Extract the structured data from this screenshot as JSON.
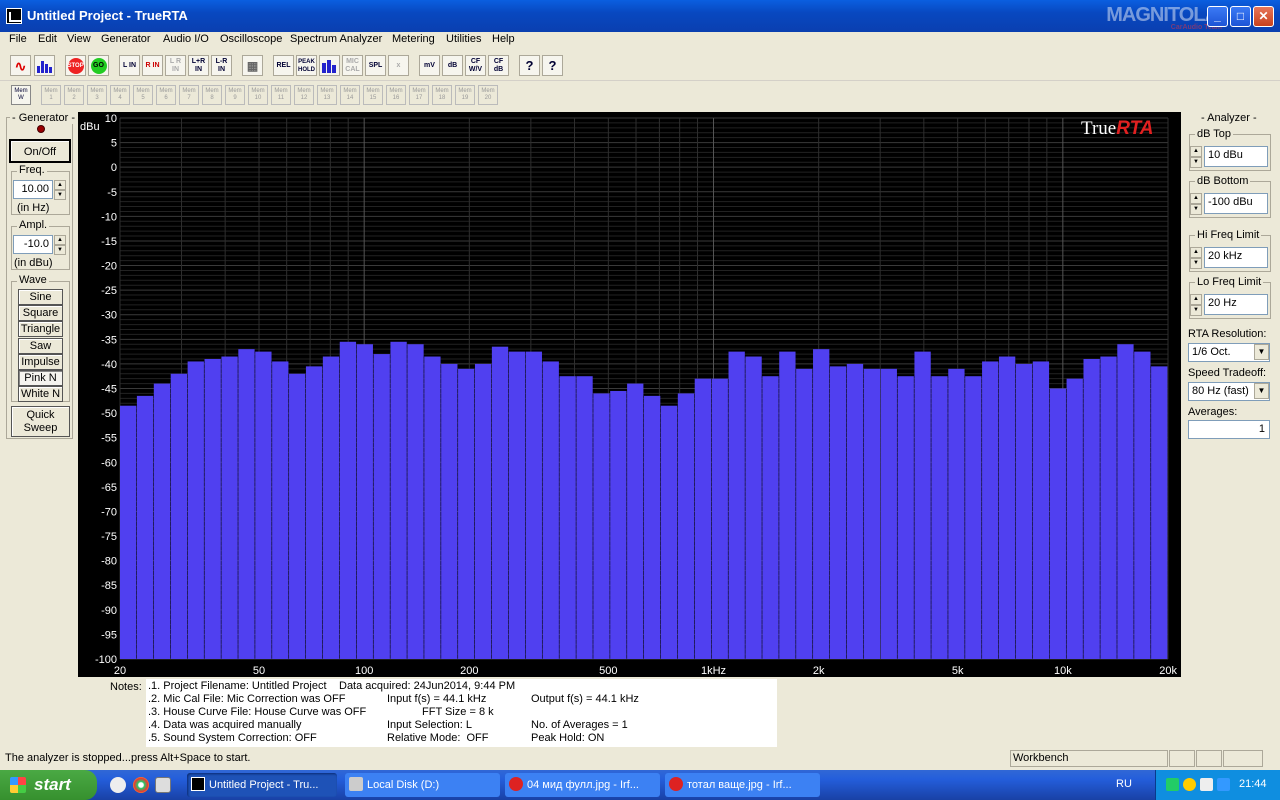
{
  "window": {
    "title": "Untitled Project - TrueRTA"
  },
  "watermark": {
    "brand": "MAGNITOLA",
    "sub": "CarAudio Team"
  },
  "menu": [
    "File",
    "Edit",
    "View",
    "Generator",
    "Audio I/O",
    "Oscilloscope",
    "Spectrum Analyzer",
    "Metering",
    "Utilities",
    "Help"
  ],
  "toolbar": {
    "buttons": [
      "sine-wave",
      "spectrum",
      "STOP",
      "GO",
      "L IN",
      "R IN",
      "L R IN",
      "L+R IN",
      "L-R IN",
      "grid",
      "REL",
      "PEAK HOLD",
      "bars",
      "MIC CAL",
      "SPL",
      "x",
      "mV",
      "dB",
      "CF W/V",
      "CF dB",
      "?",
      "?"
    ]
  },
  "memories": {
    "first": "Mem W",
    "items": [
      "Mem 1",
      "Mem 2",
      "Mem 3",
      "Mem 4",
      "Mem 5",
      "Mem 6",
      "Mem 7",
      "Mem 8",
      "Mem 9",
      "Mem 10",
      "Mem 11",
      "Mem 12",
      "Mem 13",
      "Mem 14",
      "Mem 15",
      "Mem 16",
      "Mem 17",
      "Mem 18",
      "Mem 19",
      "Mem 20"
    ]
  },
  "generator": {
    "title": "Generator",
    "onoff": "On/Off",
    "freq_label": "Freq.",
    "freq_value": "10.00",
    "freq_unit": "(in Hz)",
    "ampl_label": "Ampl.",
    "ampl_value": "-10.0",
    "ampl_unit": "(in dBu)",
    "wave_label": "Wave",
    "waves": [
      "Sine",
      "Square",
      "Triangle",
      "Saw",
      "Impulse",
      "Pink N",
      "White N"
    ],
    "selected_wave": "Pink N",
    "quick_sweep": "Quick Sweep"
  },
  "analyzer": {
    "title": "Analyzer",
    "db_top_label": "dB Top",
    "db_top_value": "10 dBu",
    "db_bottom_label": "dB Bottom",
    "db_bottom_value": "-100 dBu",
    "hi_freq_label": "Hi Freq Limit",
    "hi_freq_value": "20 kHz",
    "lo_freq_label": "Lo Freq Limit",
    "lo_freq_value": "20 Hz",
    "resolution_label": "RTA Resolution:",
    "resolution_value": "1/6 Oct.",
    "speed_label": "Speed Tradeoff:",
    "speed_value": "80 Hz (fast)",
    "averages_label": "Averages:",
    "averages_value": "1"
  },
  "chart_data": {
    "type": "bar",
    "logo_plain": "True",
    "logo_accent": "RTA",
    "ylabel": "dBu",
    "ylim": [
      -100,
      10
    ],
    "xlim": [
      20,
      20000
    ],
    "x_scale": "log",
    "grid": true,
    "bar_color": "#5040f0",
    "y_ticks": [
      "10",
      "5",
      "0",
      "-5",
      "-10",
      "-15",
      "-20",
      "-25",
      "-30",
      "-35",
      "-40",
      "-45",
      "-50",
      "-55",
      "-60",
      "-65",
      "-70",
      "-75",
      "-80",
      "-85",
      "-90",
      "-95",
      "-100"
    ],
    "x_ticks": [
      {
        "f": 20,
        "label": "20"
      },
      {
        "f": 50,
        "label": "50"
      },
      {
        "f": 100,
        "label": "100"
      },
      {
        "f": 200,
        "label": "200"
      },
      {
        "f": 500,
        "label": "500"
      },
      {
        "f": 1000,
        "label": "1kHz"
      },
      {
        "f": 2000,
        "label": "2k"
      },
      {
        "f": 5000,
        "label": "5k"
      },
      {
        "f": 10000,
        "label": "10k"
      },
      {
        "f": 20000,
        "label": "20k"
      }
    ],
    "values": [
      -48.5,
      -46.5,
      -44,
      -42,
      -39.5,
      -39,
      -38.5,
      -37,
      -37.5,
      -39.5,
      -42,
      -40.5,
      -38.5,
      -35.5,
      -36,
      -38,
      -35.5,
      -36,
      -38.5,
      -40,
      -41,
      -40,
      -36.5,
      -37.5,
      -37.5,
      -39.5,
      -42.5,
      -42.5,
      -46,
      -45.5,
      -44,
      -46.5,
      -48.5,
      -46,
      -43,
      -43,
      -37.5,
      -38.5,
      -42.5,
      -37.5,
      -41,
      -37,
      -40.5,
      -40,
      -41,
      -41,
      -42.5,
      -37.5,
      -42.5,
      -41,
      -42.5,
      -39.5,
      -38.5,
      -40,
      -39.5,
      -45,
      -43,
      -39,
      -38.5,
      -36,
      -37.5,
      -40.5
    ]
  },
  "notes": {
    "label": "Notes:",
    "line1": ".1. Project Filename: Untitled Project",
    "acquired": "Data acquired: 24Jun2014, 9:44 PM",
    "line2": ".2. Mic Cal File: Mic Correction was OFF",
    "input_fs": "Input f(s) = 44.1 kHz",
    "output_fs": "Output f(s) = 44.1 kHz",
    "line3": ".3. House Curve File: House Curve was OFF",
    "fft": "FFT Size = 8 k",
    "line4": ".4. Data was acquired manually",
    "input_sel": "Input Selection: L",
    "averages": "No. of Averages = 1",
    "line5": ".5. Sound System Correction: OFF",
    "relative": "Relative Mode:  OFF",
    "peak": "Peak Hold: ON"
  },
  "status": {
    "text": "The analyzer is stopped...press Alt+Space to start.",
    "workbench": "Workbench"
  },
  "taskbar": {
    "start": "start",
    "tasks": [
      "Untitled Project - Tru...",
      "Local Disk (D:)",
      "04 мид фулл.jpg - Irf...",
      "тотал ваще.jpg - Irf..."
    ],
    "lang": "RU",
    "clock": "21:44"
  }
}
